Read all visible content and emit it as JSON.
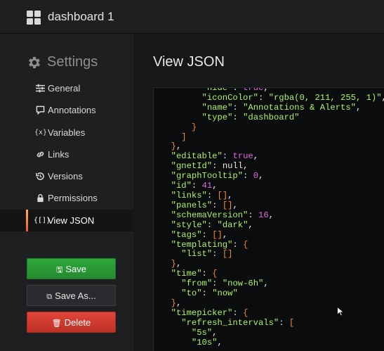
{
  "topbar": {
    "dashboard_title": "dashboard 1",
    "icon": "grid-icon"
  },
  "sidebar": {
    "title": "Settings",
    "title_icon": "gear-icon",
    "items": [
      {
        "label": "General",
        "icon": "sliders-icon",
        "active": false
      },
      {
        "label": "Annotations",
        "icon": "comment-icon",
        "active": false
      },
      {
        "label": "Variables",
        "icon": "variable-icon",
        "active": false
      },
      {
        "label": "Links",
        "icon": "link-icon",
        "active": false
      },
      {
        "label": "Versions",
        "icon": "history-icon",
        "active": false
      },
      {
        "label": "Permissions",
        "icon": "lock-icon",
        "active": false
      },
      {
        "label": "View JSON",
        "icon": "json-icon",
        "active": true
      }
    ],
    "buttons": {
      "save": "Save",
      "save_as": "Save As...",
      "delete": "Delete"
    }
  },
  "main": {
    "title": "View JSON",
    "json_lines": [
      "        \"hide\": true,",
      "        \"iconColor\": \"rgba(0, 211, 255, 1)\",",
      "        \"name\": \"Annotations & Alerts\",",
      "        \"type\": \"dashboard\"",
      "      }",
      "    ]",
      "  },",
      "  \"editable\": true,",
      "  \"gnetId\": null,",
      "  \"graphTooltip\": 0,",
      "  \"id\": 41,",
      "  \"links\": [],",
      "  \"panels\": [],",
      "  \"schemaVersion\": 16,",
      "  \"style\": \"dark\",",
      "  \"tags\": [],",
      "  \"templating\": {",
      "    \"list\": []",
      "  },",
      "  \"time\": {",
      "    \"from\": \"now-6h\",",
      "    \"to\": \"now\"",
      "  },",
      "  \"timepicker\": {",
      "    \"refresh_intervals\": [",
      "      \"5s\",",
      "      \"10s\","
    ]
  },
  "colors": {
    "background": "#161719",
    "panel": "#1e1f21",
    "accent_active": "#f05a28",
    "save": "#2da839",
    "delete": "#d9463b",
    "json_key": "#aef067",
    "json_number": "#e069e0",
    "json_bracket": "#f28b30"
  }
}
